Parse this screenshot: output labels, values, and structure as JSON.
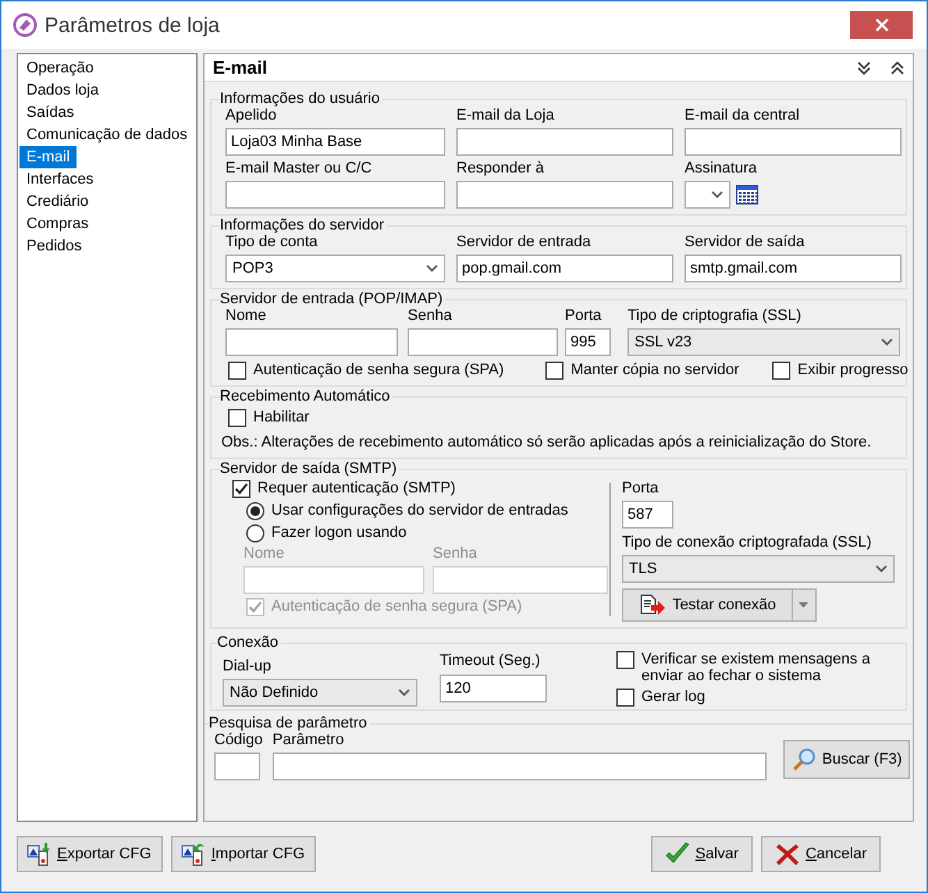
{
  "window": {
    "title": "Parâmetros de loja"
  },
  "sidebar": {
    "items": [
      {
        "label": "Operação",
        "selected": false
      },
      {
        "label": "Dados loja",
        "selected": false
      },
      {
        "label": "Saídas",
        "selected": false
      },
      {
        "label": "Comunicação de dados",
        "selected": false
      },
      {
        "label": "E-mail",
        "selected": true
      },
      {
        "label": "Interfaces",
        "selected": false
      },
      {
        "label": "Crediário",
        "selected": false
      },
      {
        "label": "Compras",
        "selected": false
      },
      {
        "label": "Pedidos",
        "selected": false
      }
    ]
  },
  "panel": {
    "title": "E-mail"
  },
  "user_info": {
    "title": "Informações do usuário",
    "fields": [
      {
        "label": "Apelido",
        "value": "Loja03 Minha Base"
      },
      {
        "label": "E-mail da Loja"
      },
      {
        "label": "E-mail da central"
      },
      {
        "label": "E-mail Master ou C/C"
      },
      {
        "label": "Responder à"
      }
    ],
    "signature": {
      "label": "Assinatura"
    }
  },
  "server_info": {
    "title": "Informações do servidor",
    "fields": [
      {
        "label": "Tipo de conta",
        "value": "POP3",
        "kind": "select"
      },
      {
        "label": "Servidor de entrada",
        "value": "pop.gmail.com",
        "kind": "text"
      },
      {
        "label": "Servidor de saída",
        "value": "smtp.gmail.com",
        "kind": "text"
      }
    ]
  },
  "incoming_server": {
    "title": "Servidor de entrada (POP/IMAP)",
    "name": {
      "label": "Nome"
    },
    "password": {
      "label": "Senha"
    },
    "port": {
      "label": "Porta",
      "value": "995"
    },
    "ssl": {
      "label": "Tipo de criptografia (SSL)",
      "value": "SSL v23"
    },
    "options": [
      {
        "label": "Autenticação de senha segura (SPA)",
        "checked": false
      },
      {
        "label": "Manter cópia no servidor",
        "checked": false
      },
      {
        "label": "Exibir progresso",
        "checked": false
      }
    ]
  },
  "auto_receive": {
    "title": "Recebimento Automático",
    "enable": {
      "label": "Habilitar",
      "checked": false
    },
    "note": "Obs.: Alterações de recebimento automático só serão aplicadas após a reinicialização do Store."
  },
  "outgoing_server": {
    "title": "Servidor de saída (SMTP)",
    "require_auth": {
      "label": "Requer autenticação (SMTP)",
      "checked": true
    },
    "modes": [
      {
        "label": "Usar configurações do servidor de entradas",
        "selected": true
      },
      {
        "label": "Fazer logon usando",
        "selected": false
      }
    ],
    "name": {
      "label": "Nome",
      "disabled": true
    },
    "password": {
      "label": "Senha",
      "disabled": true
    },
    "spa": {
      "label": "Autenticação de senha segura (SPA)",
      "checked": true,
      "disabled": true
    },
    "port": {
      "label": "Porta",
      "value": "587"
    },
    "ssl": {
      "label": "Tipo de conexão criptografada (SSL)",
      "value": "TLS"
    },
    "test_button": {
      "label": "Testar conexão"
    }
  },
  "connection": {
    "title": "Conexão",
    "dialup": {
      "label": "Dial-up",
      "value": "Não Definido"
    },
    "timeout": {
      "label": "Timeout (Seg.)",
      "value": "120"
    },
    "options": [
      {
        "label": "Verificar se existem mensagens a enviar ao fechar o sistema",
        "checked": false
      },
      {
        "label": "Gerar log",
        "checked": false
      }
    ]
  },
  "param_search": {
    "title": "Pesquisa de parâmetro",
    "code": {
      "label": "Código"
    },
    "param": {
      "label": "Parâmetro"
    },
    "button": {
      "label": "Buscar (F3)"
    }
  },
  "footer": {
    "buttons": [
      {
        "label": "Exportar CFG",
        "kind": "export",
        "underlined_first": true
      },
      {
        "label": "Importar CFG",
        "kind": "import",
        "underlined_first": true
      },
      {
        "label": "Salvar",
        "kind": "save",
        "underlined_first": true
      },
      {
        "label": "Cancelar",
        "kind": "cancel",
        "underlined_first": true
      }
    ]
  }
}
